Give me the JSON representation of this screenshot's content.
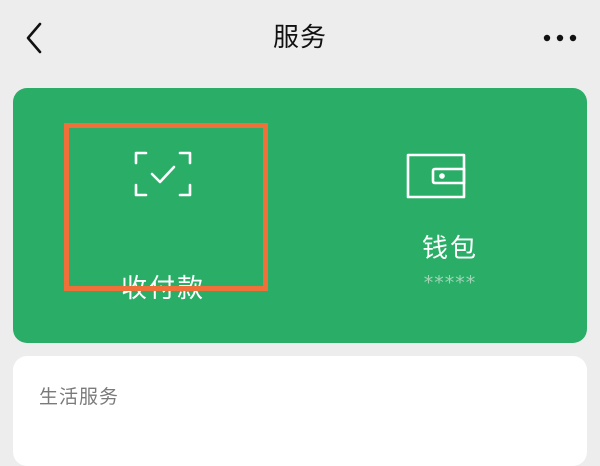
{
  "header": {
    "title": "服务",
    "back_icon": "chevron-left-icon",
    "more_icon": "more-horizontal-icon"
  },
  "services_card": {
    "pay": {
      "label": "收付款",
      "icon": "scan-check-icon",
      "highlighted": true
    },
    "wallet": {
      "label": "钱包",
      "icon": "wallet-icon",
      "balance": "*****"
    }
  },
  "life_services": {
    "title": "生活服务"
  },
  "colors": {
    "background": "#ededed",
    "card_green": "#2aae67",
    "highlight": "#f0703a",
    "text_white": "#ffffff",
    "muted_text": "#7a7a7a"
  }
}
